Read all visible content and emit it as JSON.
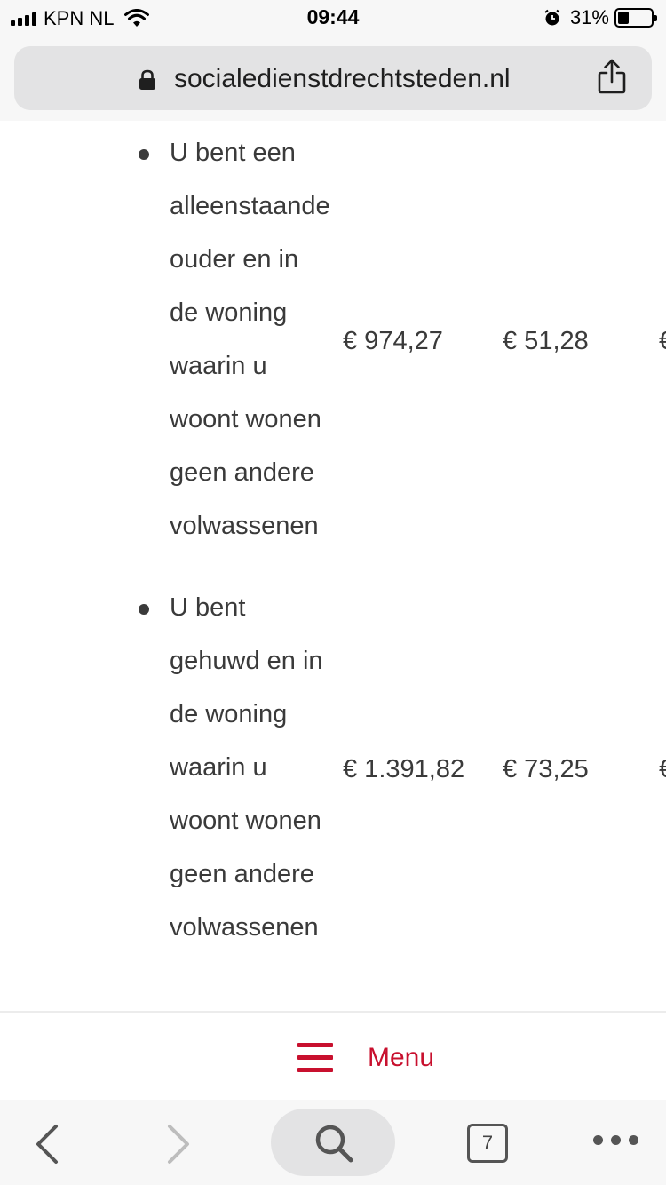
{
  "status_bar": {
    "carrier": "KPN NL",
    "time": "09:44",
    "battery": "31%",
    "battery_level": 0.31
  },
  "url_bar": {
    "url": "socialedienstdrechtsteden.nl"
  },
  "list": [
    {
      "lines": [
        "U bent een",
        "alleenstaande",
        "ouder en in",
        "de woning",
        "waarin u",
        "woont wonen",
        "geen andere",
        "volwassenen"
      ],
      "amount_1": "€ 974,27",
      "amount_2": "€ 51,28",
      "amount_3": "€"
    },
    {
      "lines": [
        "U bent",
        "gehuwd en in",
        "de woning",
        "waarin u",
        "woont wonen",
        "geen andere",
        "volwassenen"
      ],
      "amount_1": "€ 1.391,82",
      "amount_2": "€ 73,25",
      "amount_3": "€"
    }
  ],
  "menu": {
    "label": "Menu",
    "accent_color": "#c8102e"
  },
  "toolbar": {
    "tab_count": "7",
    "icons": [
      "back-icon",
      "forward-icon",
      "search-icon",
      "tabs-icon",
      "more-icon"
    ]
  }
}
